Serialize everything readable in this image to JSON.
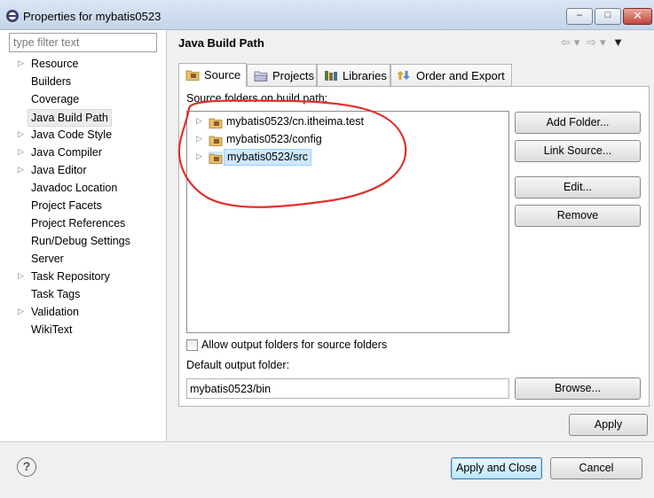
{
  "window": {
    "title": "Properties for mybatis0523",
    "minimize_glyph": "–",
    "maximize_glyph": "□",
    "close_glyph": "✕"
  },
  "filter": {
    "placeholder": "type filter text",
    "value": ""
  },
  "nav": {
    "items": [
      {
        "label": "Resource",
        "expandable": true
      },
      {
        "label": "Builders",
        "expandable": false
      },
      {
        "label": "Coverage",
        "expandable": false
      },
      {
        "label": "Java Build Path",
        "expandable": false,
        "selected": true
      },
      {
        "label": "Java Code Style",
        "expandable": true
      },
      {
        "label": "Java Compiler",
        "expandable": true
      },
      {
        "label": "Java Editor",
        "expandable": true
      },
      {
        "label": "Javadoc Location",
        "expandable": false
      },
      {
        "label": "Project Facets",
        "expandable": false
      },
      {
        "label": "Project References",
        "expandable": false
      },
      {
        "label": "Run/Debug Settings",
        "expandable": false
      },
      {
        "label": "Server",
        "expandable": false
      },
      {
        "label": "Task Repository",
        "expandable": true
      },
      {
        "label": "Task Tags",
        "expandable": false
      },
      {
        "label": "Validation",
        "expandable": true
      },
      {
        "label": "WikiText",
        "expandable": false
      }
    ]
  },
  "page": {
    "title": "Java Build Path",
    "nav_back": "⇦",
    "nav_forward": "⇨",
    "dropdown": "▾",
    "menu": "▼"
  },
  "tabs": [
    {
      "label": "Source",
      "active": true,
      "icon": "source-icon"
    },
    {
      "label": "Projects",
      "active": false,
      "icon": "projects-icon"
    },
    {
      "label": "Libraries",
      "active": false,
      "icon": "libraries-icon"
    },
    {
      "label": "Order and Export",
      "active": false,
      "icon": "order-export-icon"
    }
  ],
  "source": {
    "label": "Source folders on build path:",
    "folders": [
      {
        "label": "mybatis0523/cn.itheima.test",
        "selected": false
      },
      {
        "label": "mybatis0523/config",
        "selected": false
      },
      {
        "label": "mybatis0523/src",
        "selected": true
      }
    ],
    "buttons": {
      "add_folder": "Add Folder...",
      "link_source": "Link Source...",
      "edit": "Edit...",
      "remove": "Remove"
    },
    "allow_output_label": "Allow output folders for source folders",
    "allow_output_checked": false,
    "default_output_label": "Default output folder:",
    "default_output_value": "mybatis0523/bin",
    "browse": "Browse..."
  },
  "footer": {
    "apply": "Apply",
    "apply_and_close": "Apply and Close",
    "cancel": "Cancel",
    "help_glyph": "?"
  },
  "colors": {
    "annotation": "#e0312c",
    "selection": "#cde8ff",
    "primary_border": "#3c7fb1"
  }
}
